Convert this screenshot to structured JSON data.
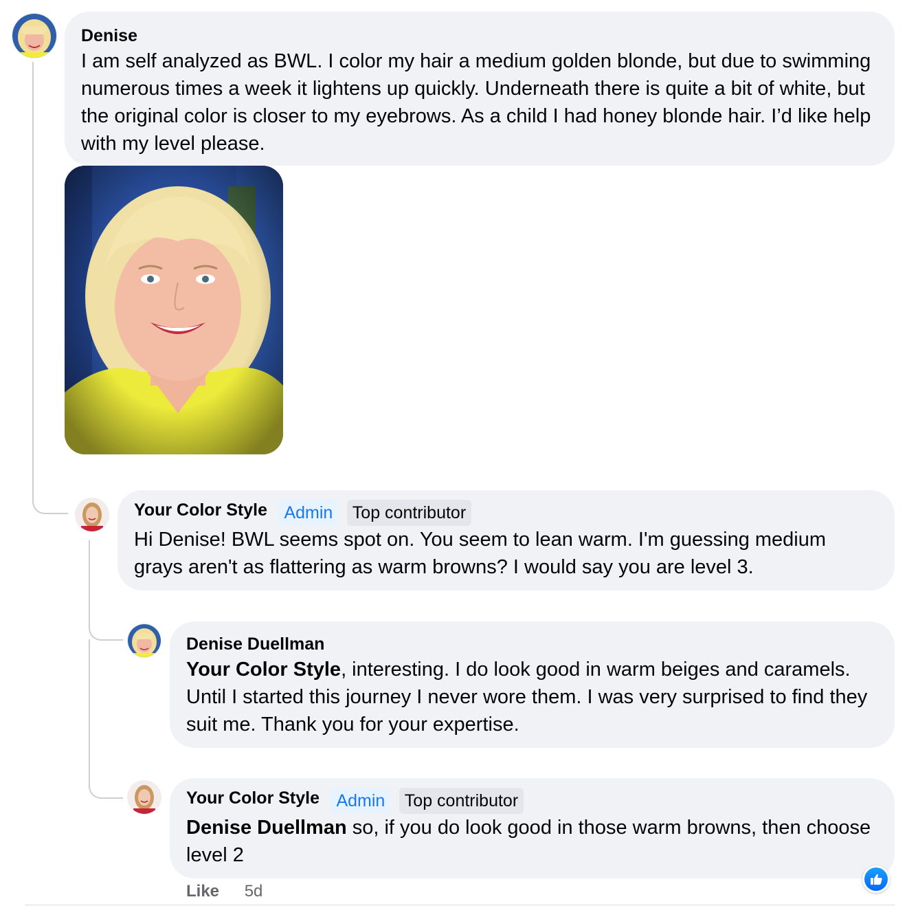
{
  "accent_color": "#1877f2",
  "bubble_color": "#f0f2f5",
  "comments": [
    {
      "author": "Denise",
      "text": "I am self analyzed as BWL. I color my hair a medium golden blonde, but due to swimming numerous times a week it lightens up quickly. Underneath there is quite a bit of white, but the original color is closer to my eyebrows. As a child I had honey blonde hair. I’d like help with my level please.",
      "attachment": "photo"
    },
    {
      "author": "Your Color Style",
      "badges": [
        "Admin",
        "Top contributor"
      ],
      "text": "Hi Denise! BWL seems spot on. You seem to lean warm. I'm guessing medium grays aren't as flattering as warm browns? I would say you are level 3."
    },
    {
      "author": "Denise Duellman",
      "mention": "Your Color Style",
      "text": ", interesting. I do look good in warm beiges and caramels. Until I started this journey I never wore them. I was very surprised to find they suit me. Thank you for your expertise."
    },
    {
      "author": "Your Color Style",
      "badges": [
        "Admin",
        "Top contributor"
      ],
      "mention": "Denise Duellman",
      "text": " so, if you do look good in those warm browns, then choose level 2",
      "actions": {
        "like": "Like",
        "time": "5d"
      },
      "reaction": "like-icon"
    }
  ]
}
